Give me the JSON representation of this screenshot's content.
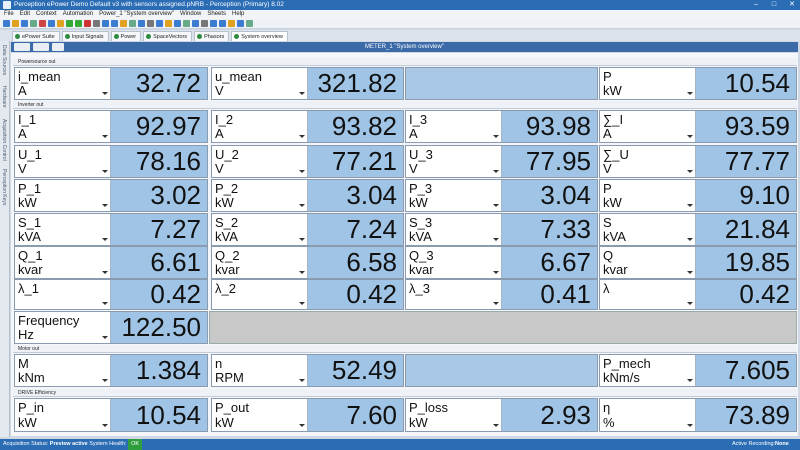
{
  "window": {
    "title": "Perception ePower Demo Default v3 with sensors assigned.pNRB - Perception (Primary) 8.02"
  },
  "menu": [
    "File",
    "Edit",
    "Context",
    "Automation",
    "Power_1 \"System overview\"",
    "Window",
    "Sheets",
    "Help"
  ],
  "tabs": [
    {
      "label": "ePower Suite"
    },
    {
      "label": "Input Signals"
    },
    {
      "label": "Power"
    },
    {
      "label": "SpaceVectors"
    },
    {
      "label": "Phasors"
    },
    {
      "label": "System overview"
    }
  ],
  "sidebar": [
    "Data Sources",
    "Hardware",
    "Acquisition Control",
    "Perception Keys"
  ],
  "document": {
    "title": "METER_1 \"System overview\""
  },
  "sections": {
    "power_source": "Powersource out",
    "inverter": "Inverter out",
    "motor": "Motor out",
    "drive": "DRIVE Efficiency"
  },
  "meters": {
    "i_mean": {
      "name": "i_mean",
      "unit": "A",
      "value": "32.72"
    },
    "u_mean": {
      "name": "u_mean",
      "unit": "V",
      "value": "321.82"
    },
    "p_src": {
      "name": "P",
      "unit": "kW",
      "value": "10.54"
    },
    "i1": {
      "name": "I_1",
      "unit": "A",
      "value": "92.97"
    },
    "i2": {
      "name": "I_2",
      "unit": "A",
      "value": "93.82"
    },
    "i3": {
      "name": "I_3",
      "unit": "A",
      "value": "93.98"
    },
    "isum": {
      "name": "∑_I",
      "unit": "A",
      "value": "93.59"
    },
    "u1": {
      "name": "U_1",
      "unit": "V",
      "value": "78.16"
    },
    "u2": {
      "name": "U_2",
      "unit": "V",
      "value": "77.21"
    },
    "u3": {
      "name": "U_3",
      "unit": "V",
      "value": "77.95"
    },
    "usum": {
      "name": "∑_U",
      "unit": "V",
      "value": "77.77"
    },
    "p1": {
      "name": "P_1",
      "unit": "kW",
      "value": "3.02"
    },
    "p2": {
      "name": "P_2",
      "unit": "kW",
      "value": "3.04"
    },
    "p3": {
      "name": "P_3",
      "unit": "kW",
      "value": "3.04"
    },
    "psum": {
      "name": "P",
      "unit": "kW",
      "value": "9.10"
    },
    "s1": {
      "name": "S_1",
      "unit": "kVA",
      "value": "7.27"
    },
    "s2": {
      "name": "S_2",
      "unit": "kVA",
      "value": "7.24"
    },
    "s3": {
      "name": "S_3",
      "unit": "kVA",
      "value": "7.33"
    },
    "ssum": {
      "name": "S",
      "unit": "kVA",
      "value": "21.84"
    },
    "q1": {
      "name": "Q_1",
      "unit": "kvar",
      "value": "6.61"
    },
    "q2": {
      "name": "Q_2",
      "unit": "kvar",
      "value": "6.58"
    },
    "q3": {
      "name": "Q_3",
      "unit": "kvar",
      "value": "6.67"
    },
    "qsum": {
      "name": "Q",
      "unit": "kvar",
      "value": "19.85"
    },
    "l1": {
      "name": "λ_1",
      "unit": "",
      "value": "0.42"
    },
    "l2": {
      "name": "λ_2",
      "unit": "",
      "value": "0.42"
    },
    "l3": {
      "name": "λ_3",
      "unit": "",
      "value": "0.41"
    },
    "lsum": {
      "name": "λ",
      "unit": "",
      "value": "0.42"
    },
    "freq": {
      "name": "Frequency",
      "unit": "Hz",
      "value": "122.50"
    },
    "m": {
      "name": "M",
      "unit": "kNm",
      "value": "1.384"
    },
    "n": {
      "name": "n",
      "unit": "RPM",
      "value": "52.49"
    },
    "pmech": {
      "name": "P_mech",
      "unit": "kNm/s",
      "value": "7.605"
    },
    "pin": {
      "name": "P_in",
      "unit": "kW",
      "value": "10.54"
    },
    "pout": {
      "name": "P_out",
      "unit": "kW",
      "value": "7.60"
    },
    "ploss": {
      "name": "P_loss",
      "unit": "kW",
      "value": "2.93"
    },
    "eta": {
      "name": "η",
      "unit": "%",
      "value": "73.89"
    }
  },
  "status": {
    "acq_label": "Acquisition Status:",
    "acq_value": "Preview active",
    "health_label": "System Health:",
    "health_value": "OK",
    "recording_label": "Active Recording:",
    "recording_value": "None"
  }
}
